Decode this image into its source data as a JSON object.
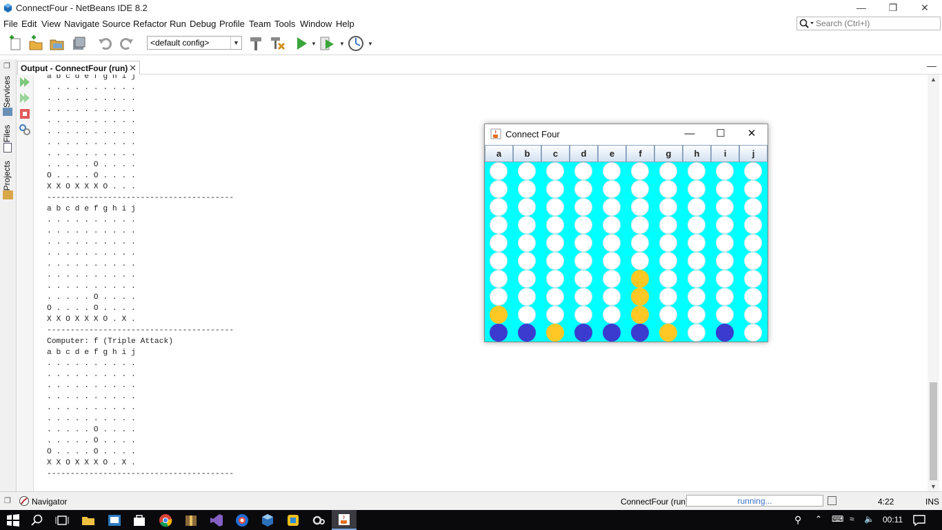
{
  "window": {
    "title": "ConnectFour - NetBeans IDE 8.2"
  },
  "menu": [
    "File",
    "Edit",
    "View",
    "Navigate",
    "Source",
    "Refactor",
    "Run",
    "Debug",
    "Profile",
    "Team",
    "Tools",
    "Window",
    "Help"
  ],
  "search": {
    "placeholder": "Search (Ctrl+I)"
  },
  "toolbar": {
    "config_value": "<default config>"
  },
  "left_tabs": [
    "Services",
    "Files",
    "Projects"
  ],
  "output": {
    "tab_label": "Output - ConnectFour (run)",
    "lines": [
      "a b c d e f g h i j",
      ". . . . . . . . . .",
      ". . . . . . . . . .",
      ". . . . . . . . . .",
      ". . . . . . . . . .",
      ". . . . . . . . . .",
      ". . . . . . . . . .",
      ". . . . . . . . . .",
      ". . . . . O . . . .",
      "O . . . . O . . . .",
      "X X O X X X O . . .",
      "----------------------------------------",
      "a b c d e f g h i j",
      ". . . . . . . . . .",
      ". . . . . . . . . .",
      ". . . . . . . . . .",
      ". . . . . . . . . .",
      ". . . . . . . . . .",
      ". . . . . . . . . .",
      ". . . . . . . . . .",
      ". . . . . O . . . .",
      "O . . . . O . . . .",
      "X X O X X X O . X .",
      "----------------------------------------",
      "Computer: f (Triple Attack)",
      "a b c d e f g h i j",
      ". . . . . . . . . .",
      ". . . . . . . . . .",
      ". . . . . . . . . .",
      ". . . . . . . . . .",
      ". . . . . . . . . .",
      ". . . . . . . . . .",
      ". . . . . O . . . .",
      ". . . . . O . . . .",
      "O . . . . O . . . .",
      "X X O X X X O . X .",
      "----------------------------------------"
    ]
  },
  "status": {
    "navigator": "Navigator",
    "run_label": "ConnectFour (run)",
    "progress_text": "running...",
    "position": "4:22",
    "mode": "INS"
  },
  "taskbar": {
    "time": "00:11"
  },
  "game": {
    "title": "Connect Four",
    "columns": [
      "a",
      "b",
      "c",
      "d",
      "e",
      "f",
      "g",
      "h",
      "i",
      "j"
    ],
    "colors": {
      "board": "#00ffff",
      "empty": "#ffffff",
      "yellow": "#ffc825",
      "blue": "#3b3bd0"
    },
    "grid": [
      "..........",
      "..........",
      "..........",
      "..........",
      "..........",
      "..........",
      ".....Y....",
      ".....Y....",
      "Y....Y....",
      "BBYBBBY.B."
    ]
  }
}
